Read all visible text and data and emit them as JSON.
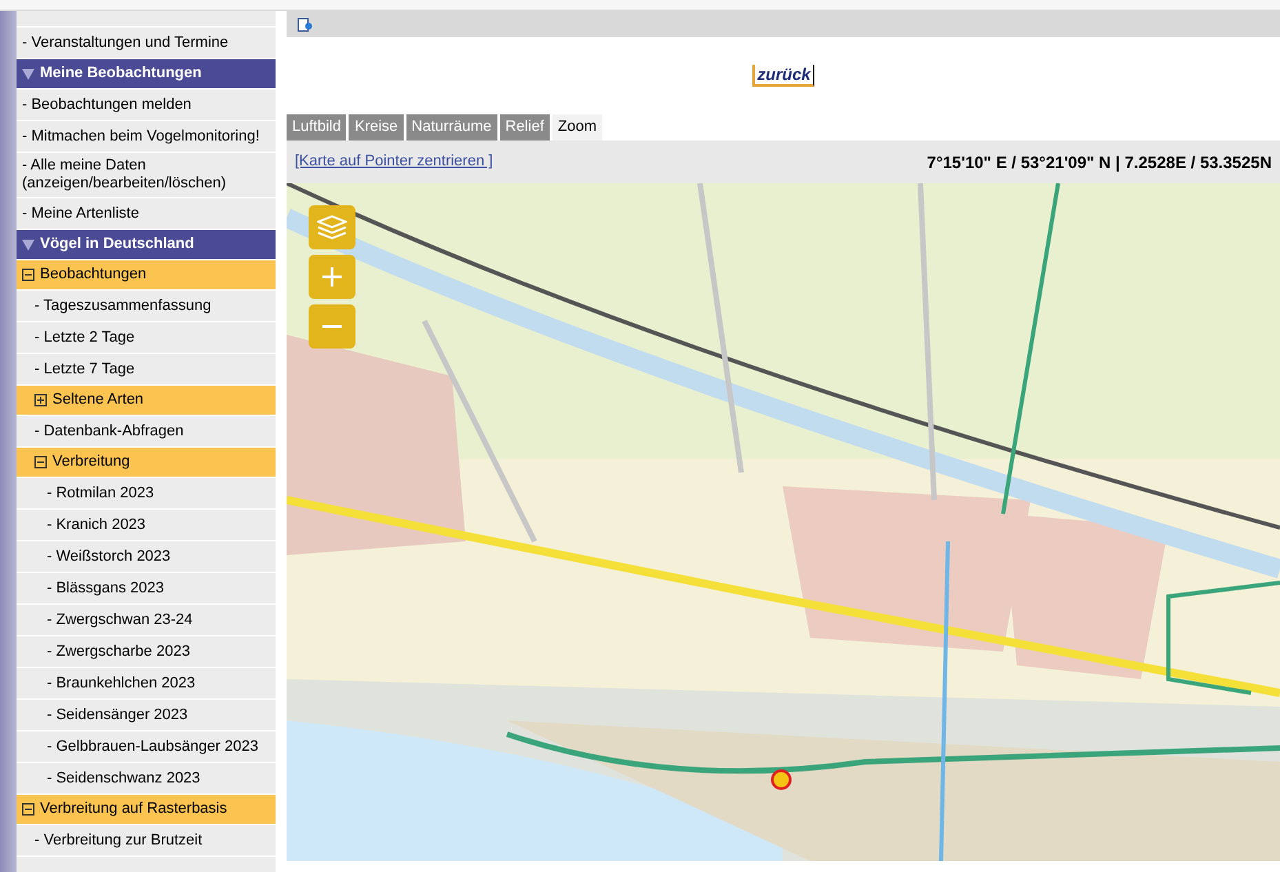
{
  "sidebar": [
    {
      "kind": "item",
      "label": "- Veranstaltungen und Termine"
    },
    {
      "kind": "section",
      "label": "Meine Beobachtungen",
      "expanded": true,
      "children": [
        {
          "kind": "item",
          "label": "- Beobachtungen melden"
        },
        {
          "kind": "item",
          "label": "- Mitmachen beim Vogelmonitoring!"
        },
        {
          "kind": "item",
          "label": "- Alle meine Daten (anzeigen/bearbeiten/löschen)"
        },
        {
          "kind": "item",
          "label": "- Meine Artenliste"
        }
      ]
    },
    {
      "kind": "section",
      "label": "Vögel in Deutschland",
      "expanded": true,
      "children": [
        {
          "kind": "group",
          "label": "Beobachtungen",
          "expanded": true,
          "children": [
            {
              "kind": "item",
              "label": "- Tageszusammenfassung"
            },
            {
              "kind": "item",
              "label": "- Letzte 2 Tage"
            },
            {
              "kind": "item",
              "label": "- Letzte 7 Tage"
            },
            {
              "kind": "group",
              "label": "Seltene Arten",
              "expanded": false
            },
            {
              "kind": "item",
              "label": "- Datenbank-Abfragen"
            },
            {
              "kind": "group",
              "label": "Verbreitung",
              "expanded": true,
              "children": [
                {
                  "kind": "item",
                  "label": "- Rotmilan 2023"
                },
                {
                  "kind": "item",
                  "label": "- Kranich 2023"
                },
                {
                  "kind": "item",
                  "label": "- Weißstorch 2023"
                },
                {
                  "kind": "item",
                  "label": "- Blässgans 2023"
                },
                {
                  "kind": "item",
                  "label": "- Zwergschwan 23-24"
                },
                {
                  "kind": "item",
                  "label": "- Zwergscharbe 2023"
                },
                {
                  "kind": "item",
                  "label": "- Braunkehlchen 2023"
                },
                {
                  "kind": "item",
                  "label": "- Seidensänger 2023"
                },
                {
                  "kind": "item",
                  "label": "- Gelbbrauen-Laubsänger 2023"
                },
                {
                  "kind": "item",
                  "label": "- Seidenschwanz 2023"
                }
              ]
            }
          ]
        },
        {
          "kind": "group",
          "label": "Verbreitung auf Rasterbasis",
          "expanded": true,
          "children": [
            {
              "kind": "item",
              "label": "- Verbreitung zur Brutzeit"
            }
          ]
        }
      ]
    }
  ],
  "back_button": "zurück",
  "tabs": [
    {
      "label": "Luftbild",
      "selected": false
    },
    {
      "label": "Kreise",
      "selected": false
    },
    {
      "label": "Naturräume",
      "selected": false
    },
    {
      "label": "Relief",
      "selected": false
    },
    {
      "label": "Zoom",
      "selected": true
    }
  ],
  "map_toolbar": {
    "link": "[Karte auf Pointer zentrieren ]",
    "coordinates": "7°15'10\" E / 53°21'09\" N | 7.2528E / 53.3525N"
  }
}
